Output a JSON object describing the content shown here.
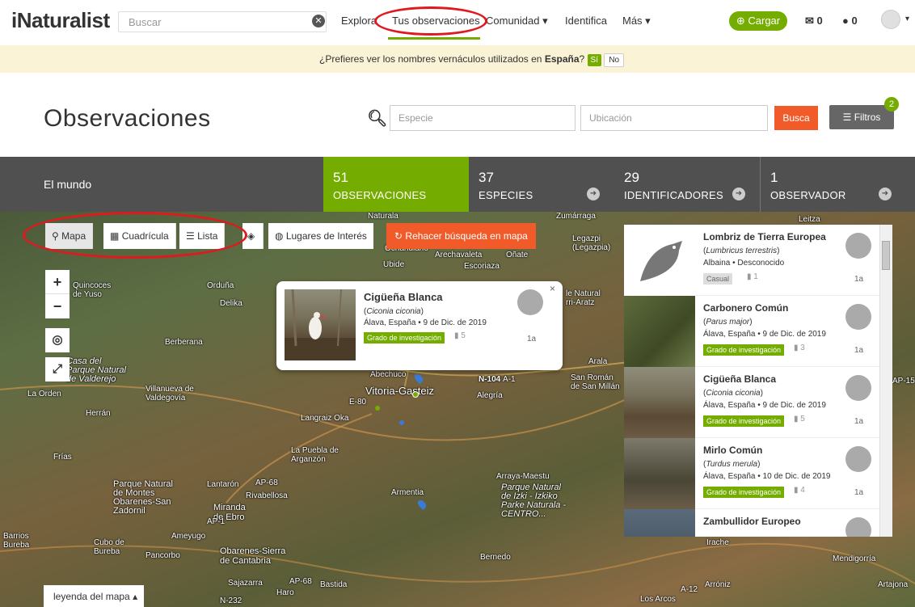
{
  "topnav": {
    "logo": "iNaturalist",
    "search_placeholder": "Buscar",
    "links": [
      "Explora",
      "Tus observaciones",
      "Comunidad ▾",
      "Identifica",
      "Más ▾"
    ],
    "upload": "Cargar",
    "messages": "0",
    "notifications": "0"
  },
  "banner": {
    "text": "¿Prefieres ver los nombres vernáculos utilizados en",
    "country": "España",
    "q": "?",
    "yes": "Sí",
    "no": "No"
  },
  "heading": {
    "title": "Observaciones",
    "species_placeholder": "Especie",
    "location_placeholder": "Ubicación",
    "search_btn": "Busca",
    "filters_btn": "Filtros",
    "filters_count": "2"
  },
  "stats": {
    "place": "El mundo",
    "items": [
      {
        "num": "51",
        "label": "OBSERVACIONES"
      },
      {
        "num": "37",
        "label": "ESPECIES"
      },
      {
        "num": "29",
        "label": "IDENTIFICADORES"
      },
      {
        "num": "1",
        "label": "OBSERVADOR"
      }
    ]
  },
  "map": {
    "tools": {
      "mapa": "Mapa",
      "cuadricula": "Cuadrícula",
      "lista": "Lista",
      "lugares": "Lugares de Interés"
    },
    "redo": "Rehacer búsqueda en mapa",
    "legend": "leyenda del mapa ▴",
    "labels": {
      "naturala": "Naturala",
      "zumarraga": "Zumárraga",
      "leitza": "Leitza",
      "quincoces": "Quincoces\nde Yuso",
      "orduna": "Orduña",
      "delika": "Delika",
      "ubide": "Ubide",
      "arechavaleta": "Arechavaleta",
      "onate": "Oñate",
      "escoriaza": "Escoriaza",
      "legazpi": "Legazpi\n(Legazpia)",
      "ochandiano": "Ochandiano",
      "berberana": "Berberana",
      "arala": "Arala",
      "abechuco": "Abechuco",
      "vitoria": "Vitoria-Gasteiz",
      "alegria": "Alegría",
      "sanroman": "San Román\nde San Millán",
      "laorden": "La Orden",
      "casa": "Casa del\nParque Natural\nde Valderejo",
      "villanueva": "Villanueva de\nValdegovía",
      "herran": "Herrán",
      "langraiz": "Langraiz Oka",
      "puebla": "La Puebla de\nArganzón",
      "frias": "Frías",
      "parque_montes": "Parque Natural\nde Montes\nObarenes-San\nZadornil",
      "lantaron": "Lantarón",
      "rivabellosa": "Rivabellosa",
      "miranda": "Miranda\nde Ebro",
      "armentia": "Armentia",
      "arraya": "Arraya-Maestu",
      "izki": "Parque Natural\nde Izki - Izkiko\nParke Naturala -\nCENTRO...",
      "barrios": "Barrios\nBureba",
      "cubo": "Cubo de\nBureba",
      "ameyugo": "Ameyugo",
      "pancorbo": "Pancorbo",
      "obarenes_sierra": "Obarenes-Sierra\nde Cantabria",
      "sajazarra": "Sajazarra",
      "haro": "Haro",
      "bastida": "Bastida",
      "bernedo": "Bernedo",
      "arroniz": "Arróniz",
      "losarcos": "Los Arcos",
      "mendigorria": "Mendigorría",
      "artajona": "Artajona",
      "irache": "Irache",
      "n104": "N-104",
      "a1": "A-1",
      "e80": "E-80",
      "ap68": "AP-68",
      "ap1": "AP-1",
      "ap15": "AP-15",
      "a12": "A-12",
      "naturalzona": "le Natural\nrri-Aratz",
      "n232": "N-232"
    }
  },
  "popup": {
    "name": "Cigüeña Blanca",
    "sci": "Ciconia ciconia",
    "location": "Álava, España • 9 de Dic. de 2019",
    "grade": "Grado de investigación",
    "count": "5",
    "age": "1a"
  },
  "list": [
    {
      "name": "Lombriz de Tierra Europea",
      "sci": "Lumbricus terrestris",
      "loc": "Albaina • Desconocido",
      "grade": "Casual",
      "count": "1",
      "age": "1a"
    },
    {
      "name": "Carbonero Común",
      "sci": "Parus major",
      "loc": "Álava, España • 9 de Dic. de 2019",
      "grade": "Grado de investigación",
      "count": "3",
      "age": "1a"
    },
    {
      "name": "Cigüeña Blanca",
      "sci": "Ciconia ciconia",
      "loc": "Álava, España • 9 de Dic. de 2019",
      "grade": "Grado de investigación",
      "count": "5",
      "age": "1a"
    },
    {
      "name": "Mirlo Común",
      "sci": "Turdus merula",
      "loc": "Álava, España • 10 de Dic. de 2019",
      "grade": "Grado de investigación",
      "count": "4",
      "age": "1a"
    },
    {
      "name": "Zambullidor Europeo",
      "sci": "",
      "loc": "",
      "grade": "",
      "count": "",
      "age": ""
    }
  ],
  "colors": {
    "accent": "#74ac00",
    "orange": "#f15a29",
    "stats_bg": "#505050",
    "annotation": "#e0191f"
  }
}
